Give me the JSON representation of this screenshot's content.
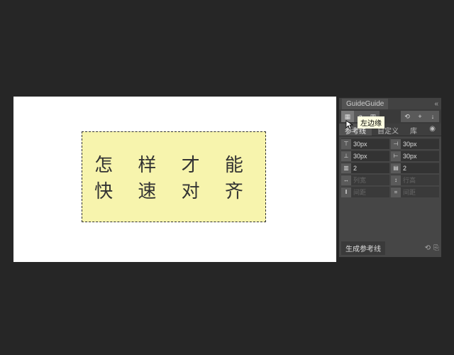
{
  "artboard": {
    "line1": "怎 样 才 能",
    "line2": "快 速 对 齐"
  },
  "panel": {
    "title": "GuideGuide",
    "close": "«",
    "tooltip": "左边缘",
    "modes": {
      "m1": "▦",
      "m2": "⌀",
      "m3": "▥",
      "m4": "⟲",
      "m5": "+",
      "m6": "↓"
    },
    "tabs": {
      "t1": "参考线",
      "t2": "自定义",
      "t3": "库",
      "eye": "◉"
    },
    "fields": {
      "topMargin": {
        "ico": "⊤",
        "val": "30px"
      },
      "rightMargin": {
        "ico": "⊣",
        "val": "30px"
      },
      "bottomMargin": {
        "ico": "⊥",
        "val": "30px"
      },
      "leftMargin": {
        "ico": "⊢",
        "val": "30px"
      },
      "cols": {
        "ico": "▥",
        "val": "2"
      },
      "rows": {
        "ico": "▤",
        "val": "2"
      },
      "colW": {
        "ico": "↔",
        "val": "列宽"
      },
      "rowH": {
        "ico": "↕",
        "val": "行高"
      },
      "gutW": {
        "ico": "‖",
        "val": "间距"
      },
      "gutH": {
        "ico": "=",
        "val": "间距"
      }
    },
    "generate": "生成参考线",
    "footer": {
      "i1": "⟲",
      "i2": "⎘"
    }
  }
}
